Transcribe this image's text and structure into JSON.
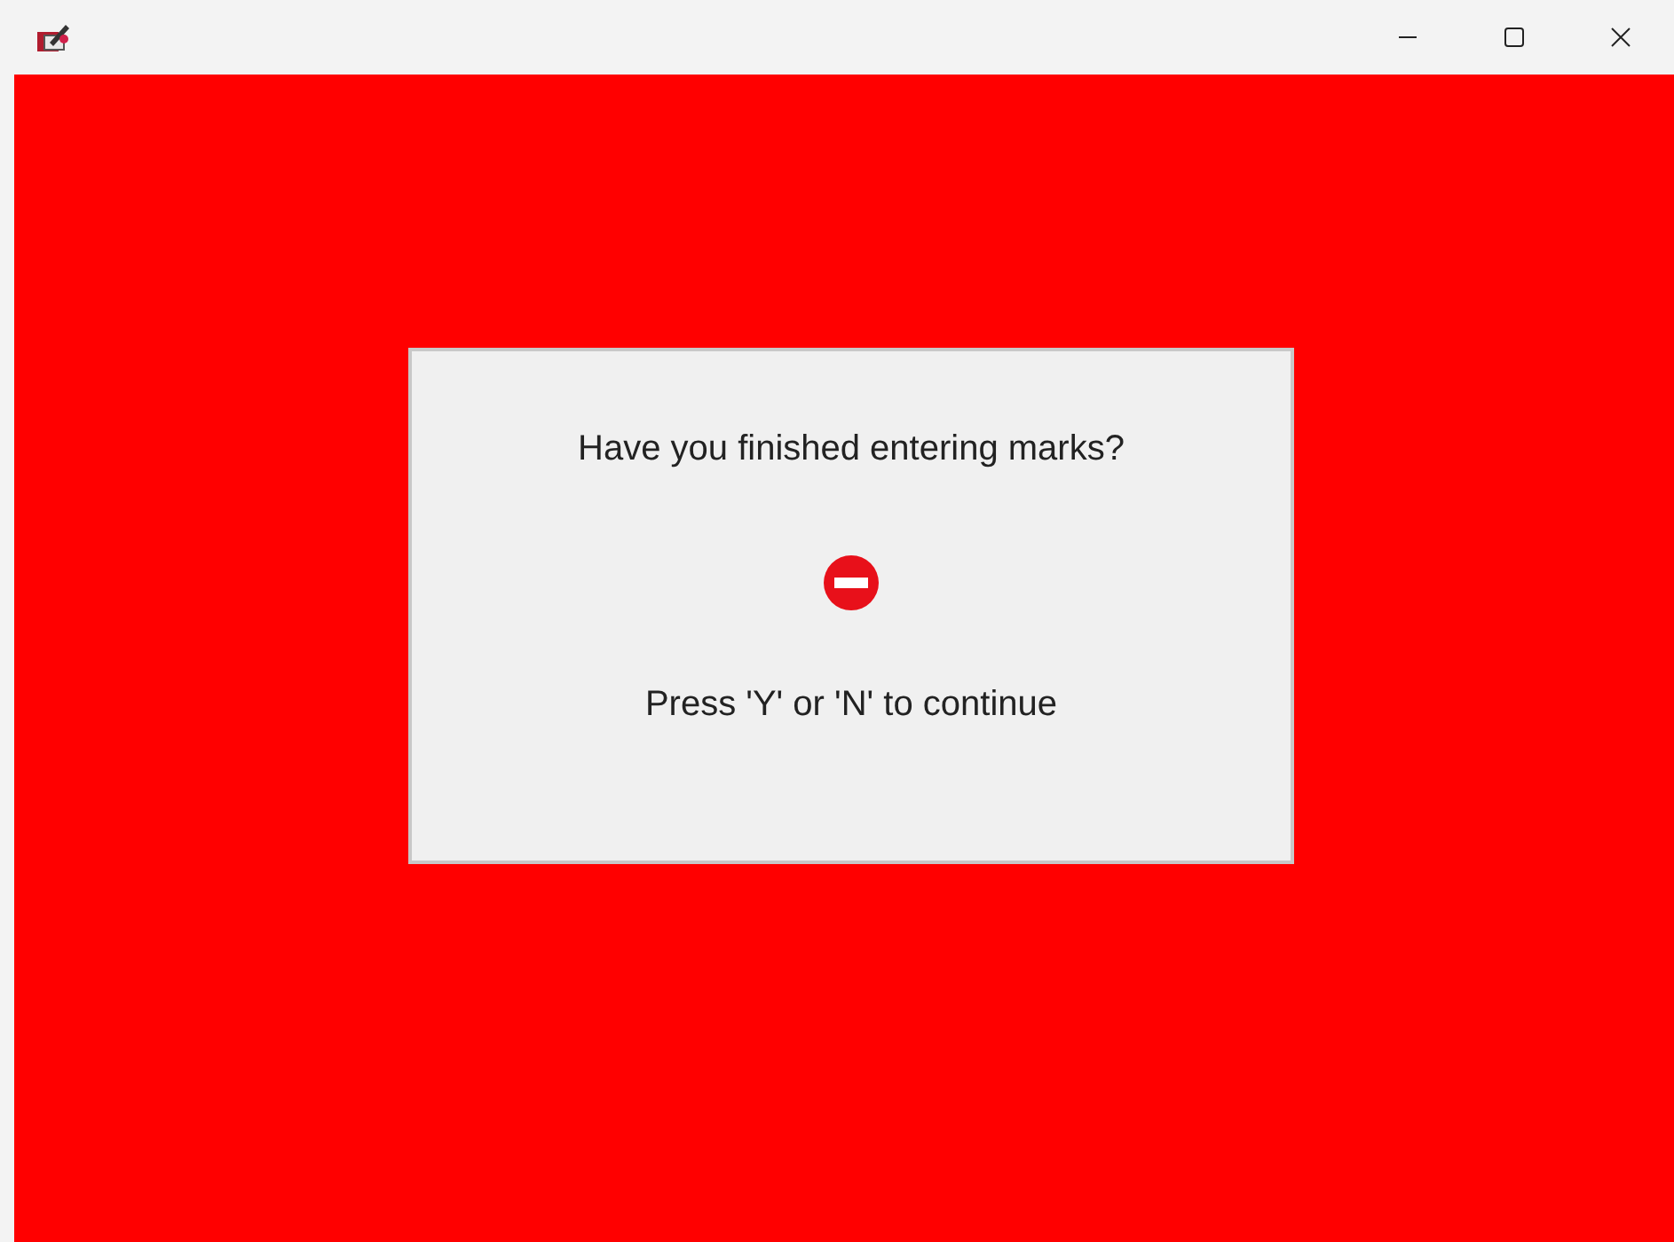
{
  "dialog": {
    "question": "Have you finished entering marks?",
    "prompt": "Press 'Y' or 'N' to continue"
  }
}
